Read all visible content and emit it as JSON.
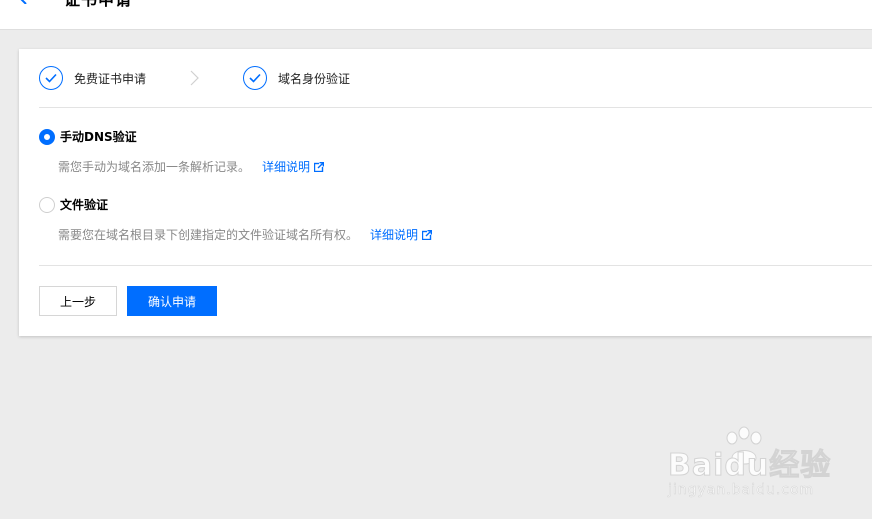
{
  "header": {
    "title": "证书申请",
    "back_icon": "chevron-left-icon"
  },
  "steps": [
    {
      "label": "免费证书申请",
      "icon": "check-icon",
      "status": "done"
    },
    {
      "label": "域名身份验证",
      "icon": "check-icon",
      "status": "done"
    }
  ],
  "step_separator_icon": "chevron-right-icon",
  "options": [
    {
      "title": "手动DNS验证",
      "description": "需您手动为域名添加一条解析记录。",
      "link": "详细说明",
      "link_icon": "external-link-icon",
      "selected": true
    },
    {
      "title": "文件验证",
      "description": "需要您在域名根目录下创建指定的文件验证域名所有权。",
      "link": "详细说明",
      "link_icon": "external-link-icon",
      "selected": false
    }
  ],
  "buttons": {
    "prev": "上一步",
    "confirm": "确认申请"
  },
  "watermark": {
    "brand": "Baidu经验",
    "url": "jingyan.baidu.com"
  },
  "colors": {
    "accent": "#006eff",
    "page_bg": "#ececec",
    "card_bg": "#ffffff",
    "muted_text": "#888888"
  }
}
